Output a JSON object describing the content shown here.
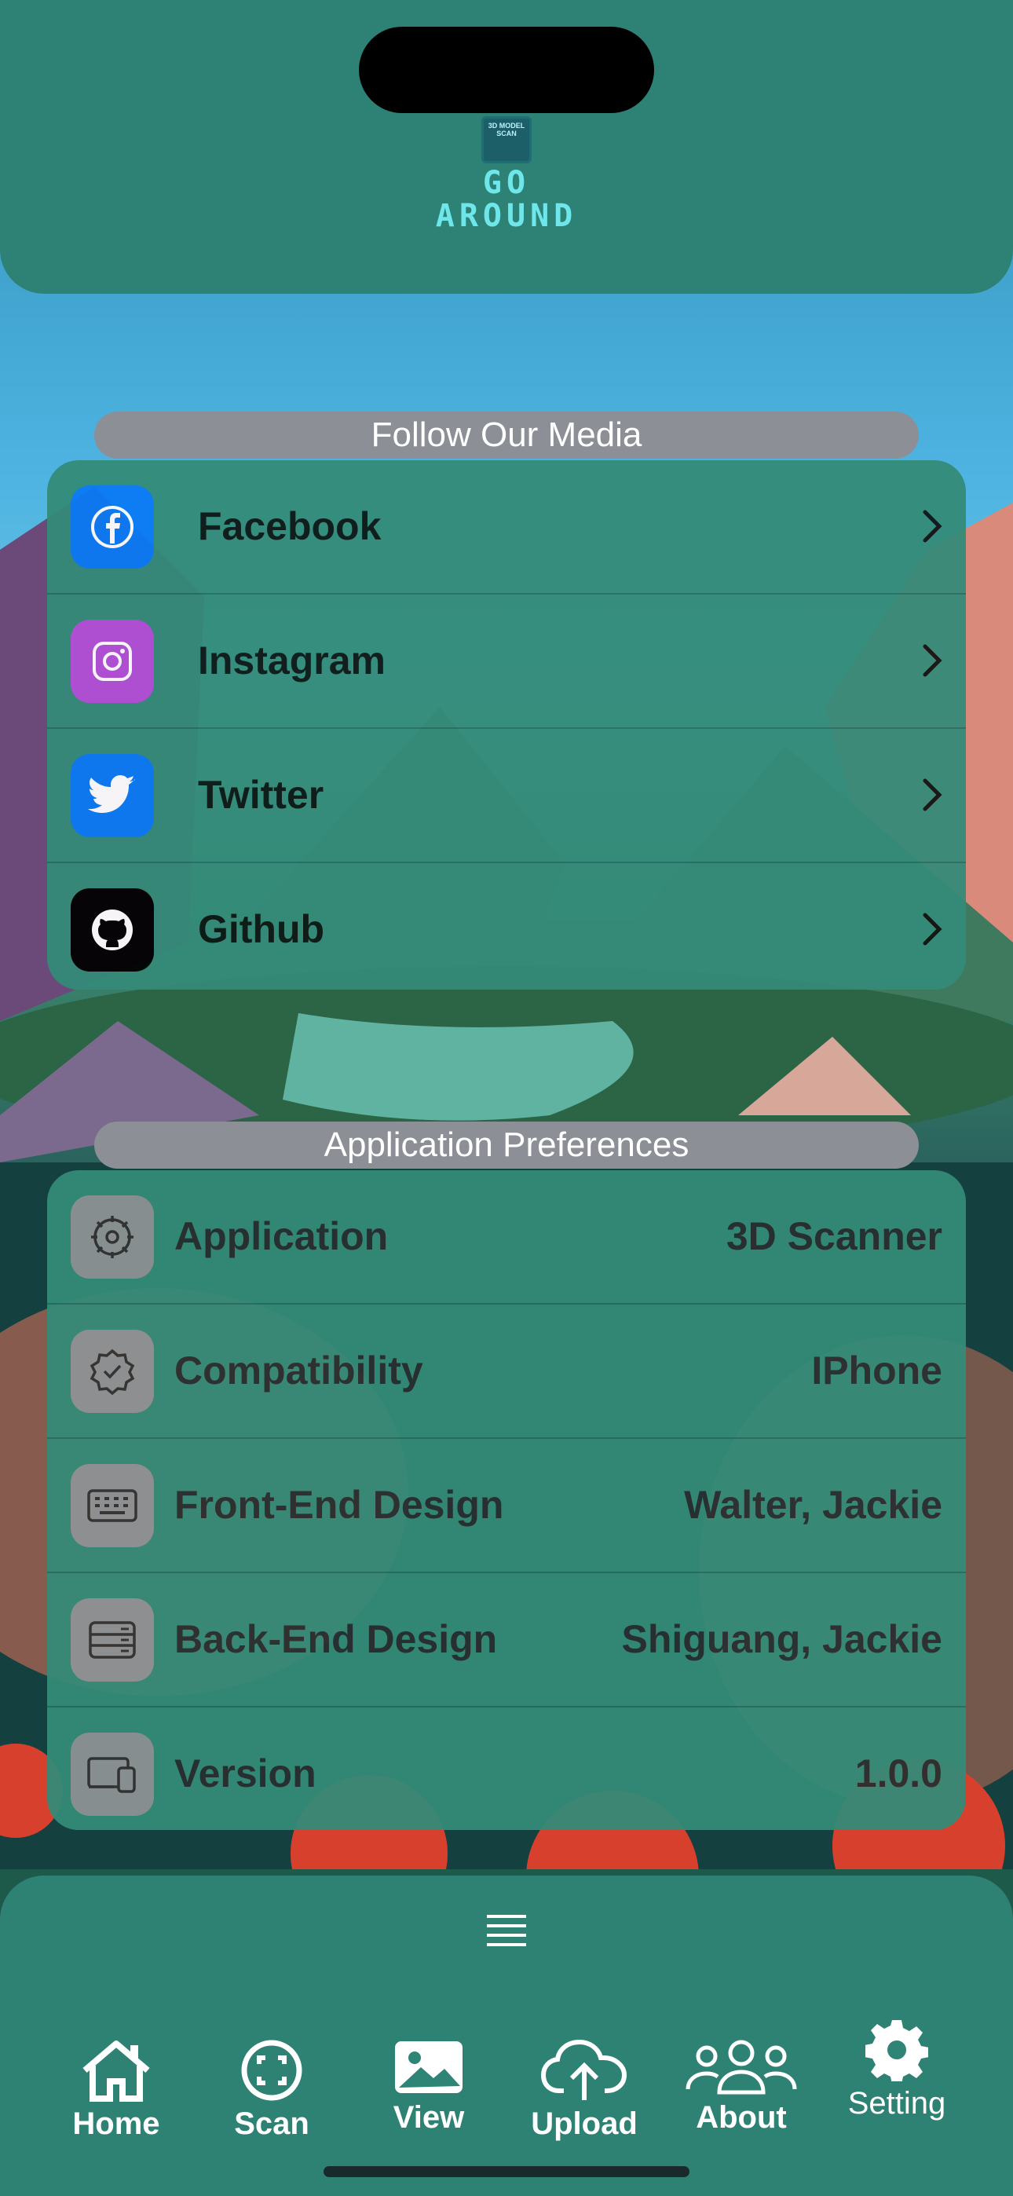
{
  "app": {
    "logo_caption": "3D MODEL SCAN",
    "logo_line1": "GO",
    "logo_line2": "AROUND"
  },
  "media": {
    "section_title": "Follow Our Media",
    "items": [
      {
        "label": "Facebook",
        "icon": "facebook-icon",
        "color": "#0a7af5"
      },
      {
        "label": "Instagram",
        "icon": "instagram-icon",
        "color": "#b350d8"
      },
      {
        "label": "Twitter",
        "icon": "twitter-icon",
        "color": "#0a7af5"
      },
      {
        "label": "Github",
        "icon": "github-icon",
        "color": "#000000"
      }
    ]
  },
  "prefs": {
    "section_title": "Application Preferences",
    "items": [
      {
        "label": "Application",
        "value": "3D Scanner",
        "icon": "gear-outline-icon"
      },
      {
        "label": "Compatibility",
        "value": "IPhone",
        "icon": "checkmark-seal-icon"
      },
      {
        "label": "Front-End Design",
        "value": "Walter, Jackie",
        "icon": "keyboard-icon"
      },
      {
        "label": "Back-End Design",
        "value": "Shiguang, Jackie",
        "icon": "server-icon"
      },
      {
        "label": "Version",
        "value": "1.0.0",
        "icon": "devices-icon"
      }
    ]
  },
  "tabbar": {
    "tabs": [
      {
        "label": "Home",
        "icon": "house-icon"
      },
      {
        "label": "Scan",
        "icon": "scan-icon"
      },
      {
        "label": "View",
        "icon": "photo-icon"
      },
      {
        "label": "Upload",
        "icon": "cloud-upload-icon"
      },
      {
        "label": "About",
        "icon": "people-icon"
      },
      {
        "label": "Setting",
        "icon": "gear-icon"
      }
    ]
  },
  "colors": {
    "card": "#348b78",
    "pill": "#8d8f96",
    "accent_logo": "#6fe7ea"
  }
}
